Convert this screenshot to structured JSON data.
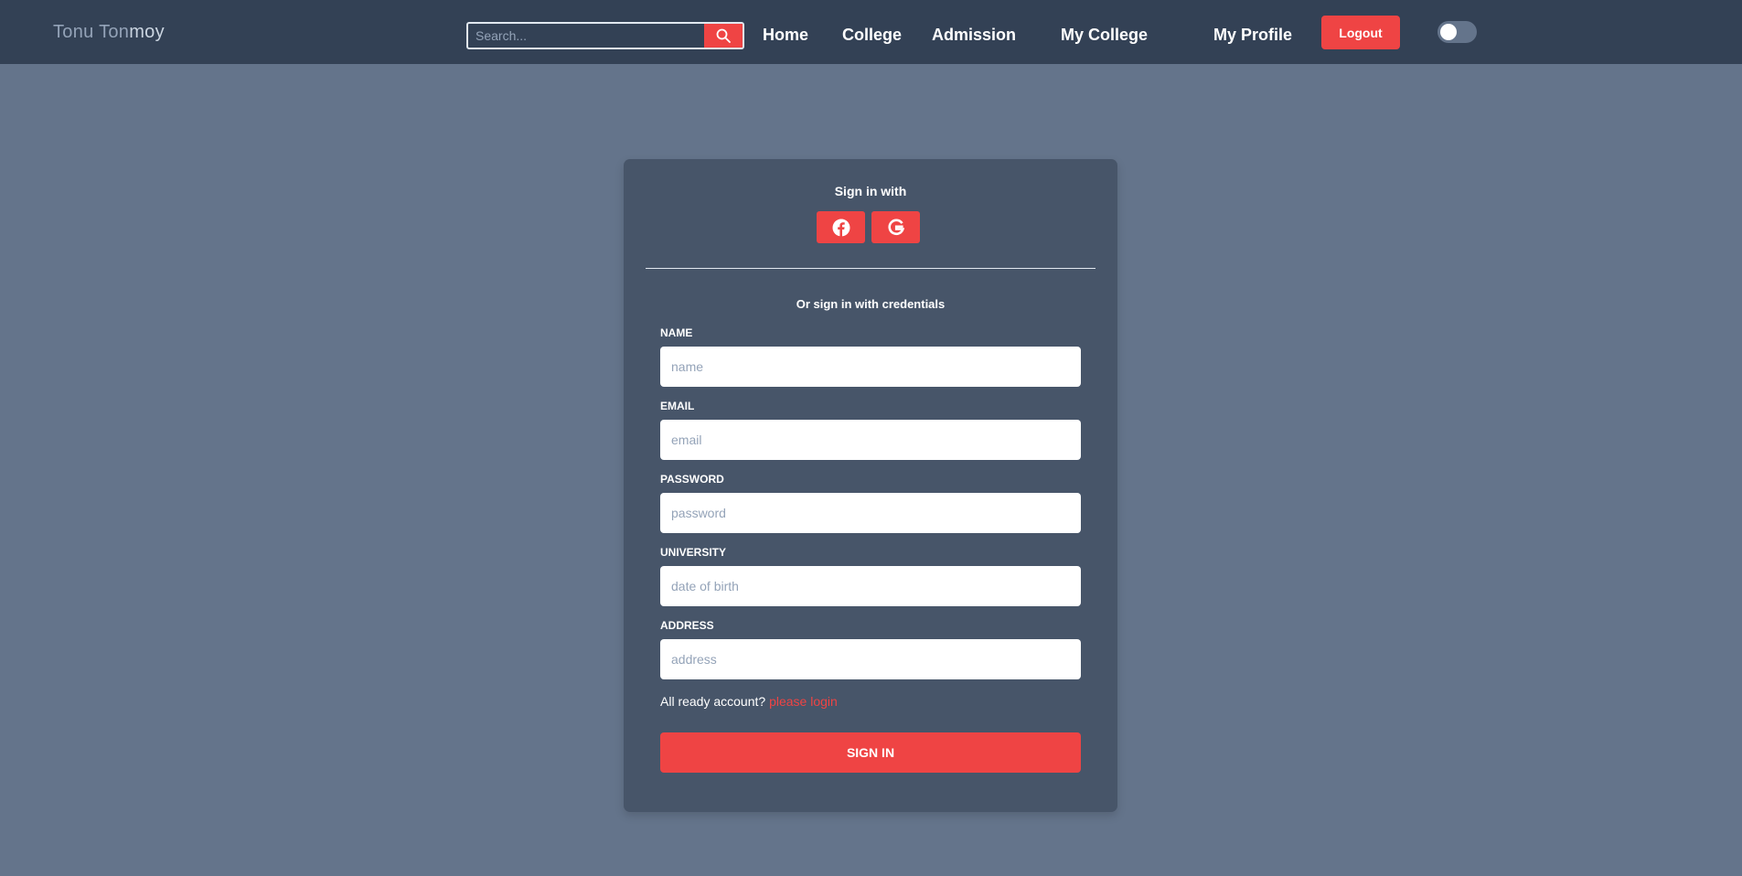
{
  "navbar": {
    "brand_part1": "Tonu Ton",
    "brand_part2": "moy",
    "search_placeholder": "Search...",
    "search_icon": "search-icon",
    "links": [
      "Home",
      "College",
      "Admission",
      "My College",
      "My Profile"
    ],
    "logout_label": "Logout",
    "theme_toggle_on": false
  },
  "card": {
    "title": "Sign in with",
    "social": [
      {
        "name": "facebook-icon"
      },
      {
        "name": "google-icon"
      }
    ],
    "subtitle": "Or sign in with credentials",
    "fields": [
      {
        "label": "NAME",
        "placeholder": "name",
        "value": ""
      },
      {
        "label": "EMAIL",
        "placeholder": "email",
        "value": ""
      },
      {
        "label": "PASSWORD",
        "placeholder": "password",
        "value": ""
      },
      {
        "label": "UNIVERSITY",
        "placeholder": "date of birth",
        "value": ""
      },
      {
        "label": "ADDRESS",
        "placeholder": "address",
        "value": ""
      }
    ],
    "account_text": "All ready account?",
    "login_link": "please login",
    "submit_label": "SIGN IN"
  },
  "colors": {
    "page_bg": "#64748b",
    "navbar_bg": "#334155",
    "card_bg": "#475569",
    "accent": "#ef4444"
  }
}
